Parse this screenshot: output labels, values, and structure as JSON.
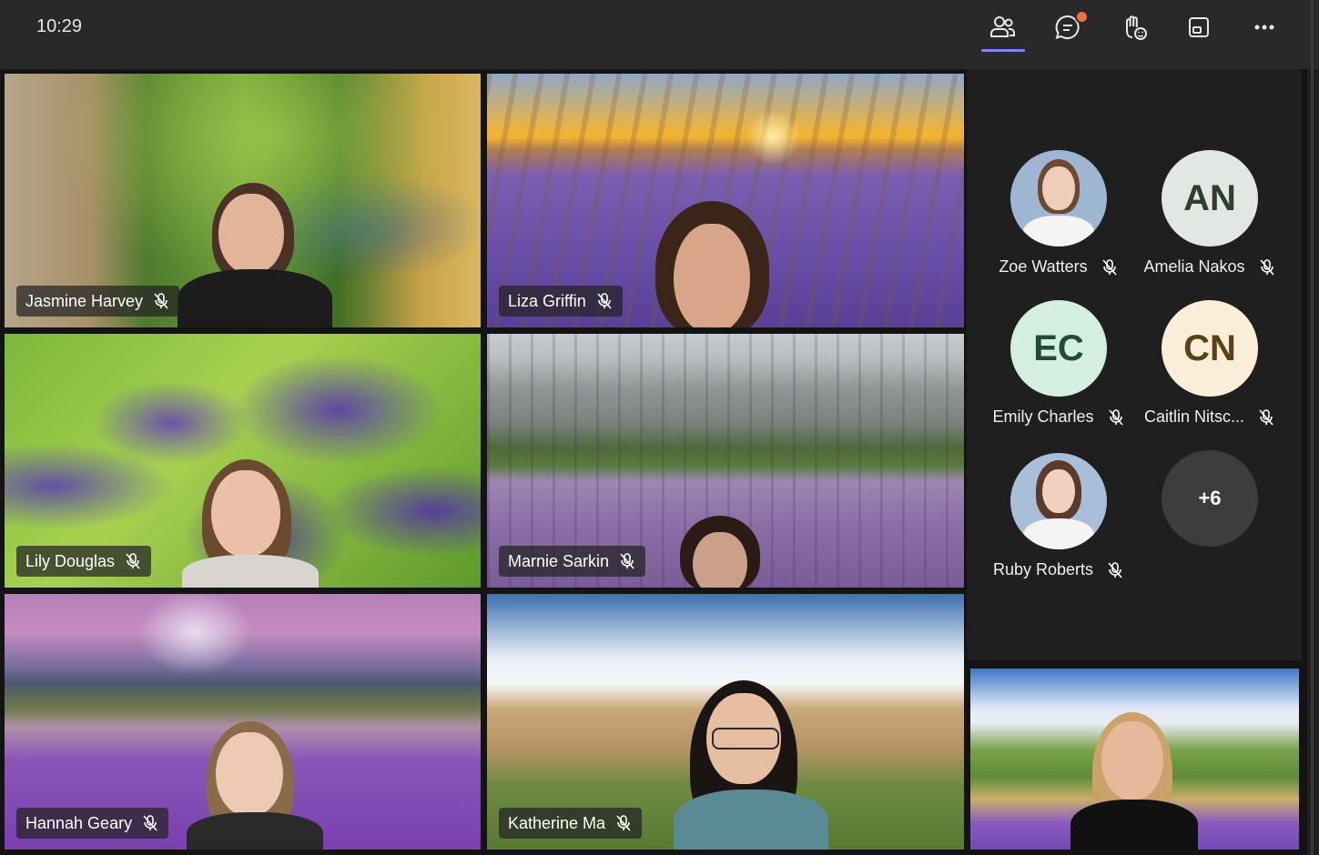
{
  "status_bar": {
    "time": "10:29"
  },
  "toolbar": {
    "people_icon": "people-icon",
    "chat_icon": "chat-icon",
    "react_icon": "raise-hand-react-icon",
    "share_icon": "share-screen-icon",
    "more_icon": "more-icon",
    "accent_color": "#7f85f5",
    "notification_color": "#f0703c"
  },
  "video_tiles": [
    {
      "name": "Jasmine Harvey"
    },
    {
      "name": "Liza Griffin"
    },
    {
      "name": "Lily Douglas"
    },
    {
      "name": "Marnie Sarkin"
    },
    {
      "name": "Hannah Geary"
    },
    {
      "name": "Katherine Ma"
    }
  ],
  "participant_rail": {
    "participants": [
      {
        "name": "Zoe Watters",
        "initials": "",
        "has_photo": true
      },
      {
        "name": "Amelia Nakos",
        "initials": "AN",
        "avatar_color": "#e3e7e3",
        "text_color": "#2f3e2f"
      },
      {
        "name": "Emily Charles",
        "initials": "EC",
        "avatar_color": "#d4efe0",
        "text_color": "#1f4d35"
      },
      {
        "name": "Caitlin Nitsc...",
        "initials": "CN",
        "avatar_color": "#fbeed8",
        "text_color": "#5a4218"
      },
      {
        "name": "Ruby Roberts",
        "initials": "",
        "has_photo": true
      }
    ],
    "overflow_label": "+6"
  }
}
